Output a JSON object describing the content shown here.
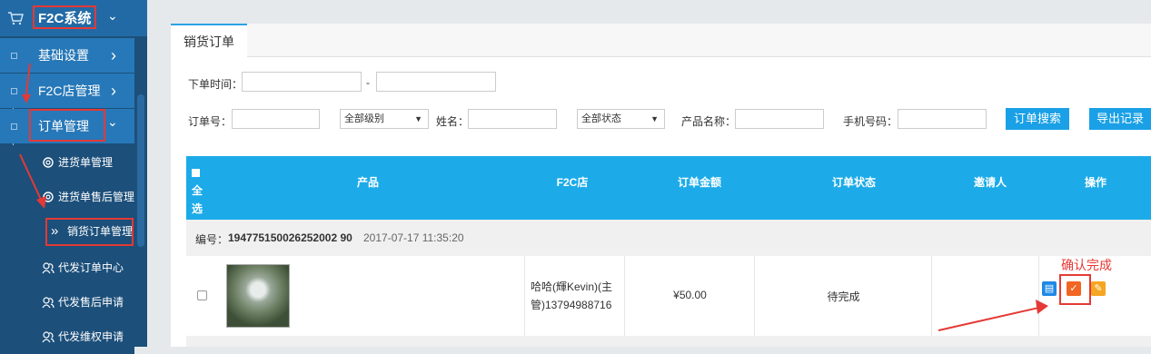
{
  "sidebar": {
    "system_label": "F2C系统",
    "items": [
      {
        "label": "基础设置"
      },
      {
        "label": "F2C店管理"
      },
      {
        "label": "订单管理"
      }
    ],
    "subitems": [
      {
        "label": "进货单管理"
      },
      {
        "label": "进货单售后管理"
      },
      {
        "label": "销货订单管理"
      },
      {
        "label": "代发订单中心"
      },
      {
        "label": "代发售后申请"
      },
      {
        "label": "代发维权申请"
      }
    ],
    "chevron_right": "›",
    "chevron_down": "⌄",
    "double_chevron": "»"
  },
  "tab": {
    "label": "销货订单"
  },
  "filters": {
    "order_time_label": "下单时间：",
    "range_sep": "-",
    "order_no_label": "订单号：",
    "level_select": "全部级别",
    "name_label": "姓名：",
    "status_select": "全部状态",
    "product_name_label": "产品名称：",
    "phone_label": "手机号码：",
    "search_button": "订单搜索",
    "export_button": "导出记录"
  },
  "table": {
    "headers": {
      "select_all": "全选",
      "product": "产品",
      "store": "F2C店",
      "amount": "订单金额",
      "status": "订单状态",
      "inviter": "邀请人",
      "actions": "操作"
    },
    "order": {
      "number_label": "编号：",
      "number": "194775150026252002 90",
      "time": "2017-07-17 11:35:20",
      "store_line1": "哈哈(輝Kevin)(主",
      "store_line2": "管)13794988716",
      "amount": "¥50.00",
      "status": "待完成",
      "inviter": ""
    }
  },
  "annotation": {
    "confirm_label": "确认完成"
  },
  "colors": {
    "sidebar_bg": "#1c4f7a",
    "sidebar_item": "#2778b8",
    "accent": "#1cabe8",
    "highlight": "#e53935"
  }
}
